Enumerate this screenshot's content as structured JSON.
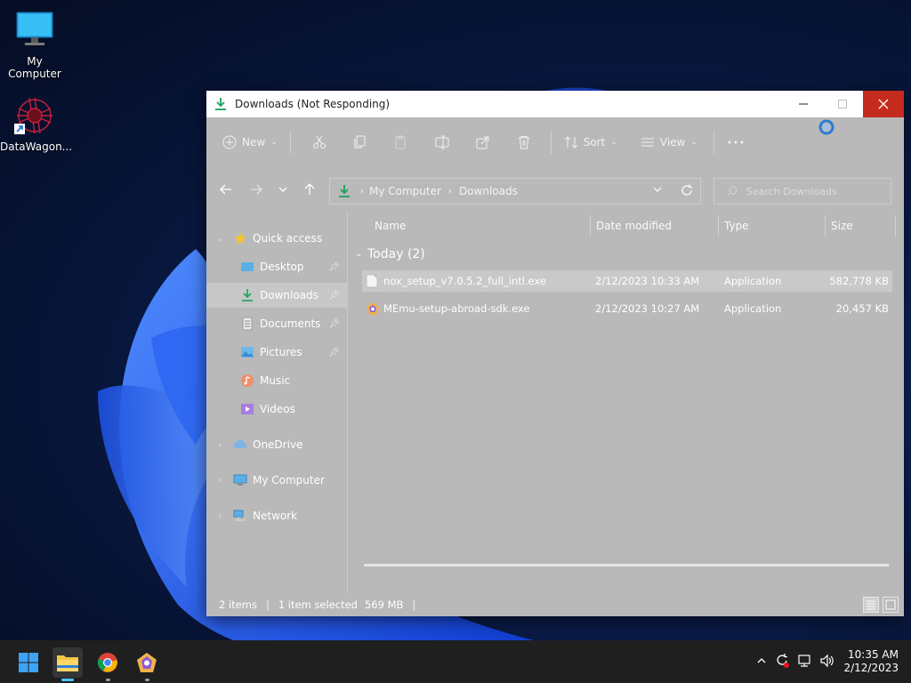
{
  "desktop": {
    "icons": [
      {
        "label": "My Computer"
      },
      {
        "label": "DataWagon..."
      }
    ]
  },
  "window": {
    "title": "Downloads (Not Responding)",
    "toolbar": {
      "new_label": "New",
      "sort_label": "Sort",
      "view_label": "View"
    },
    "address": {
      "crumbs": [
        "My Computer",
        "Downloads"
      ],
      "search_placeholder": "Search Downloads"
    },
    "nav": {
      "quick_access": "Quick access",
      "pinned": [
        {
          "label": "Desktop",
          "icon": "desktop-folder-icon"
        },
        {
          "label": "Downloads",
          "icon": "download-folder-icon"
        },
        {
          "label": "Documents",
          "icon": "documents-folder-icon"
        },
        {
          "label": "Pictures",
          "icon": "pictures-folder-icon"
        },
        {
          "label": "Music",
          "icon": "music-folder-icon"
        },
        {
          "label": "Videos",
          "icon": "videos-folder-icon"
        }
      ],
      "onedrive": "OneDrive",
      "my_computer": "My Computer",
      "network": "Network"
    },
    "columns": {
      "name": "Name",
      "date": "Date modified",
      "type": "Type",
      "size": "Size"
    },
    "group_label": "Today (2)",
    "files": [
      {
        "name": "nox_setup_v7.0.5.2_full_intl.exe",
        "date": "2/12/2023 10:33 AM",
        "type": "Application",
        "size": "582,778 KB"
      },
      {
        "name": "MEmu-setup-abroad-sdk.exe",
        "date": "2/12/2023 10:27 AM",
        "type": "Application",
        "size": "20,457 KB"
      }
    ],
    "status": {
      "items": "2 items",
      "selected": "1 item selected",
      "selected_size": "569 MB"
    }
  },
  "taskbar": {
    "clock_time": "10:35 AM",
    "clock_date": "2/12/2023"
  },
  "colors": {
    "accent": "#0078d4",
    "close_red": "#c42b1c",
    "download_green": "#1aa260"
  }
}
